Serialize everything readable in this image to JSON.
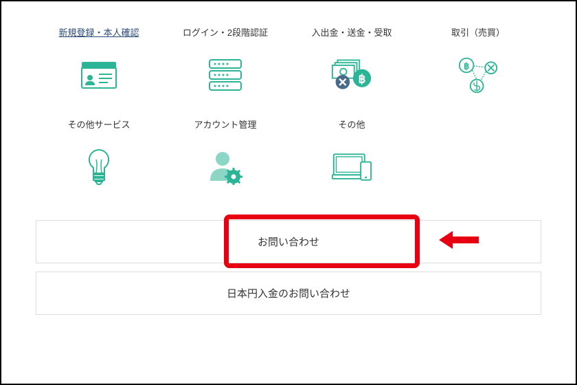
{
  "categories": [
    {
      "label": "新規登録・本人確認",
      "icon": "id-card-icon",
      "active": true
    },
    {
      "label": "ログイン・2段階認証",
      "icon": "password-fields-icon",
      "active": false
    },
    {
      "label": "入出金・送金・受取",
      "icon": "money-transfer-icon",
      "active": false
    },
    {
      "label": "取引（売買）",
      "icon": "crypto-trade-icon",
      "active": false
    },
    {
      "label": "その他サービス",
      "icon": "lightbulb-icon",
      "active": false
    },
    {
      "label": "アカウント管理",
      "icon": "user-gear-icon",
      "active": false
    },
    {
      "label": "その他",
      "icon": "devices-icon",
      "active": false
    }
  ],
  "buttons": {
    "contact": "お問い合わせ",
    "jpy_deposit_contact": "日本円入金のお問い合わせ"
  },
  "colors": {
    "accent": "#2bb596",
    "highlight": "#e60012",
    "text": "#333333"
  }
}
